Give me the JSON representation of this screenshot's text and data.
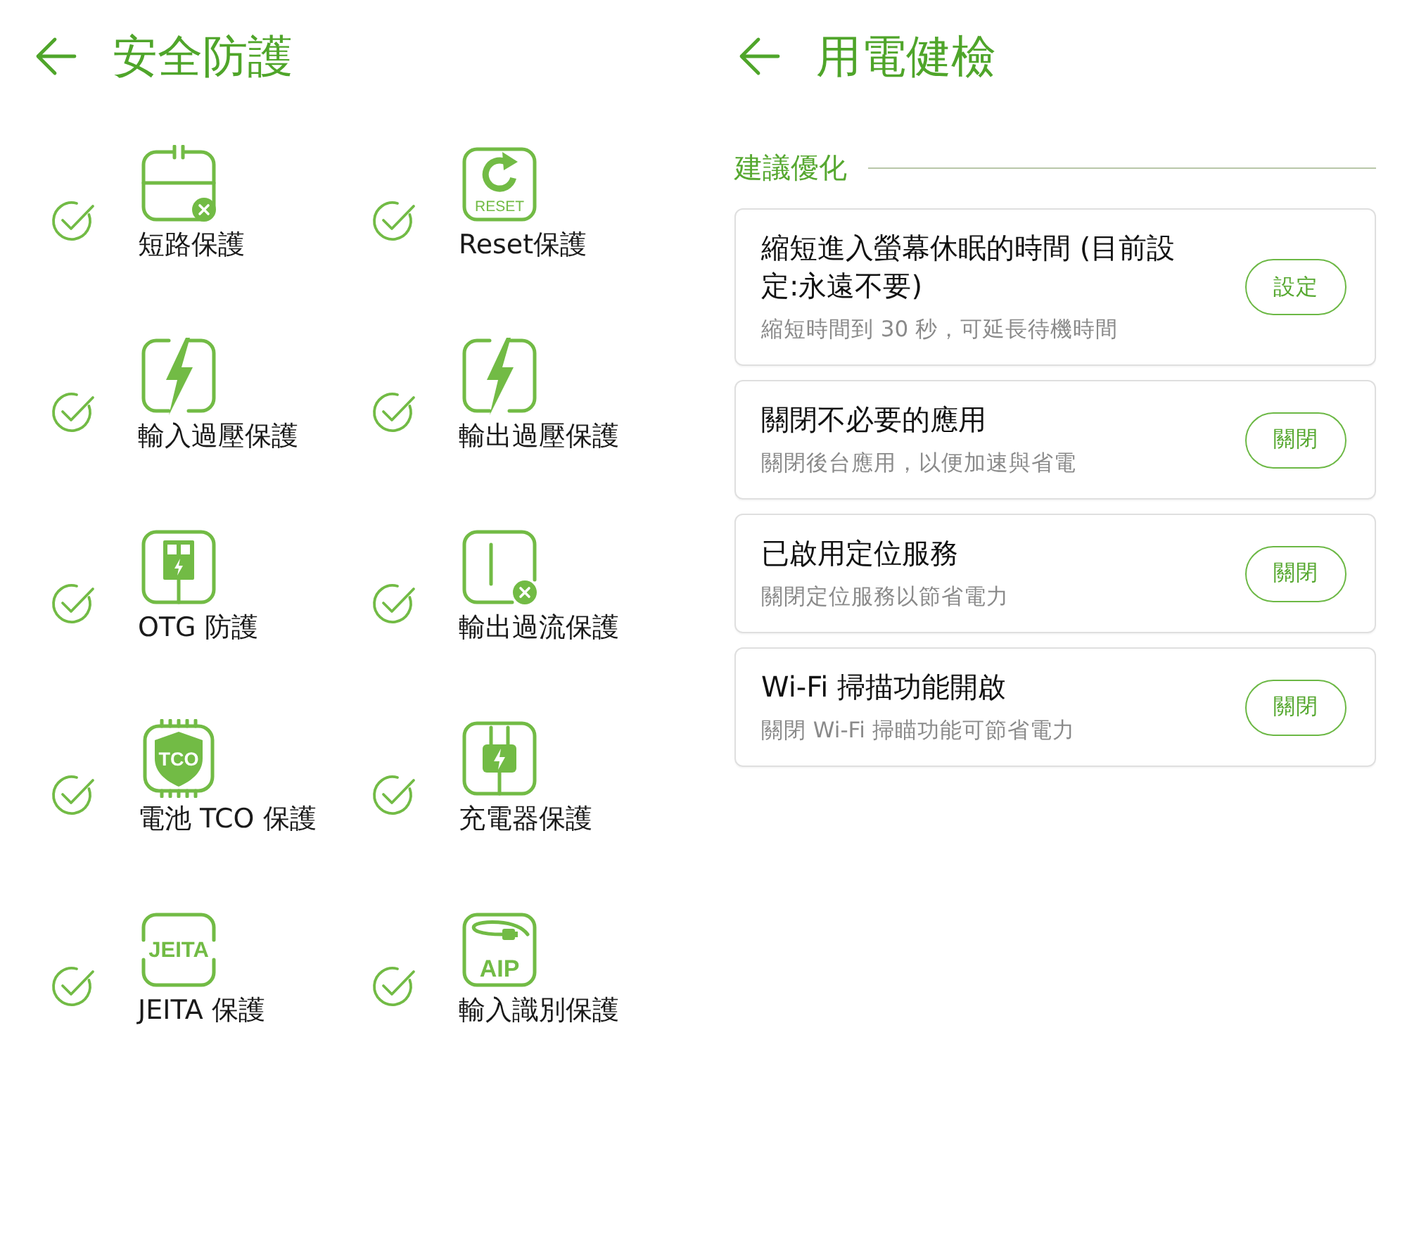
{
  "left_screen": {
    "title": "安全防護",
    "rows": [
      {
        "items": [
          {
            "kind": "circuit",
            "label": "短路保護",
            "checked": true
          },
          {
            "kind": "reset",
            "icon_text": "RESET",
            "label": "Reset保護",
            "checked": true
          }
        ]
      },
      {
        "items": [
          {
            "kind": "bolt",
            "label": "輸入過壓保護",
            "checked": true
          },
          {
            "kind": "bolt",
            "label": "輸出過壓保護",
            "checked": true
          }
        ]
      },
      {
        "items": [
          {
            "kind": "usb",
            "label": "OTG 防護",
            "checked": true
          },
          {
            "kind": "current",
            "label": "輸出過流保護",
            "checked": true
          }
        ]
      },
      {
        "items": [
          {
            "kind": "shield",
            "icon_text": "TCO",
            "label": "電池 TCO 保護",
            "checked": true
          },
          {
            "kind": "charger",
            "label": "充電器保護",
            "checked": true
          }
        ]
      },
      {
        "items": [
          {
            "kind": "badge",
            "icon_text": "JEITA",
            "label": "JEITA 保護",
            "checked": true
          },
          {
            "kind": "cable",
            "icon_text": "AIP",
            "label": "輸入識別保護",
            "checked": true
          }
        ]
      }
    ]
  },
  "right_screen": {
    "title": "用電健檢",
    "section_title": "建議優化",
    "suggestions": [
      {
        "title": "縮短進入螢幕休眠的時間 (目前設定:永遠不要)",
        "description": "縮短時間到 30 秒，可延長待機時間",
        "button": "設定"
      },
      {
        "title": "關閉不必要的應用",
        "description": "關閉後台應用，以便加速與省電",
        "button": "關閉"
      },
      {
        "title": "已啟用定位服務",
        "description": "關閉定位服務以節省電力",
        "button": "關閉"
      },
      {
        "title": "Wi-Fi 掃描功能開啟",
        "description": "關閉 Wi-Fi 掃瞄功能可節省電力",
        "button": "關閉"
      }
    ]
  }
}
